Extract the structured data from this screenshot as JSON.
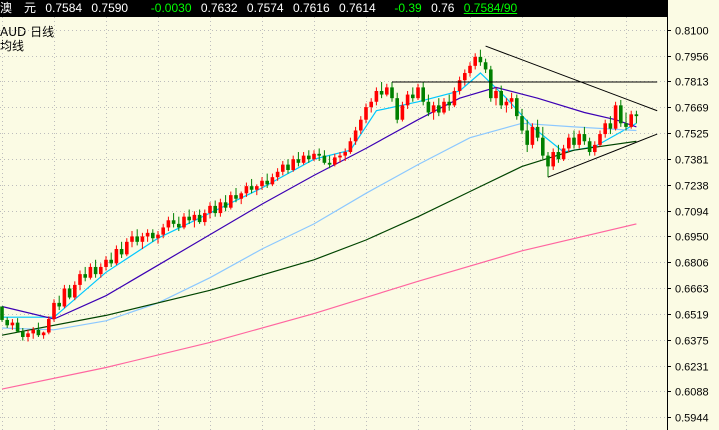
{
  "header": {
    "instrument": "澳　元",
    "open": "0.7584",
    "last": "0.7590",
    "change": "-0.0030",
    "high": "0.7632",
    "low": "0.7574",
    "prev": "0.7616",
    "bid": "0.7614",
    "change_pct": "-0.39",
    "spread": "0.76",
    "latest": "0.7584/90"
  },
  "chart_labels": {
    "symbol": "AUD",
    "period": "日线",
    "line2": "均线"
  },
  "colors": {
    "background": "#fbfbe4",
    "grid": "#bdbdbd",
    "up_candle": "#ff0000",
    "down_candle": "#008000",
    "ma_short": "#00c8ff",
    "ma_mid": "#3c00b4",
    "ma_long": "#8cc8ff",
    "ma_200": "#004400",
    "ma_500": "#ff66a0",
    "trendline": "#000000",
    "axis_bg": "#fbfbe4"
  },
  "chart_data": {
    "type": "candlestick",
    "y_ticks": [
      "0.8100",
      "0.7956",
      "0.7813",
      "0.7669",
      "0.7525",
      "0.7381",
      "0.7238",
      "0.7094",
      "0.6950",
      "0.6806",
      "0.6663",
      "0.6519",
      "0.6375",
      "0.6231",
      "0.6088",
      "0.5944"
    ],
    "ylim": [
      0.5872,
      0.8172
    ],
    "x_count": 125,
    "grid": true,
    "candles": [
      [
        0,
        0.656,
        0.652,
        0.6475,
        0.6485
      ],
      [
        1,
        0.6485,
        0.65,
        0.644,
        0.6455
      ],
      [
        2,
        0.6455,
        0.649,
        0.643,
        0.647
      ],
      [
        3,
        0.647,
        0.6495,
        0.6415,
        0.642
      ],
      [
        4,
        0.642,
        0.644,
        0.637,
        0.639
      ],
      [
        5,
        0.639,
        0.643,
        0.6365,
        0.641
      ],
      [
        6,
        0.641,
        0.6445,
        0.638,
        0.643
      ],
      [
        7,
        0.643,
        0.647,
        0.639,
        0.64
      ],
      [
        8,
        0.64,
        0.642,
        0.638,
        0.6415
      ],
      [
        9,
        0.6415,
        0.6505,
        0.6405,
        0.649
      ],
      [
        10,
        0.649,
        0.66,
        0.6475,
        0.658
      ],
      [
        11,
        0.658,
        0.662,
        0.654,
        0.656
      ],
      [
        12,
        0.656,
        0.668,
        0.655,
        0.666
      ],
      [
        13,
        0.666,
        0.668,
        0.66,
        0.661
      ],
      [
        14,
        0.661,
        0.67,
        0.6595,
        0.668
      ],
      [
        15,
        0.668,
        0.676,
        0.665,
        0.674
      ],
      [
        16,
        0.674,
        0.678,
        0.67,
        0.672
      ],
      [
        17,
        0.672,
        0.68,
        0.671,
        0.678
      ],
      [
        18,
        0.678,
        0.682,
        0.672,
        0.674
      ],
      [
        19,
        0.674,
        0.68,
        0.672,
        0.678
      ],
      [
        20,
        0.678,
        0.684,
        0.676,
        0.682
      ],
      [
        21,
        0.682,
        0.686,
        0.678,
        0.68
      ],
      [
        22,
        0.68,
        0.69,
        0.679,
        0.688
      ],
      [
        23,
        0.688,
        0.692,
        0.683,
        0.685
      ],
      [
        24,
        0.685,
        0.694,
        0.684,
        0.692
      ],
      [
        25,
        0.692,
        0.698,
        0.689,
        0.695
      ],
      [
        26,
        0.695,
        0.699,
        0.69,
        0.692
      ],
      [
        27,
        0.692,
        0.697,
        0.688,
        0.695
      ],
      [
        28,
        0.695,
        0.699,
        0.692,
        0.697
      ],
      [
        29,
        0.697,
        0.699,
        0.692,
        0.694
      ],
      [
        30,
        0.694,
        0.698,
        0.691,
        0.696
      ],
      [
        31,
        0.696,
        0.702,
        0.694,
        0.7
      ],
      [
        32,
        0.7,
        0.706,
        0.698,
        0.704
      ],
      [
        33,
        0.704,
        0.708,
        0.7,
        0.702
      ],
      [
        34,
        0.702,
        0.706,
        0.698,
        0.7
      ],
      [
        35,
        0.7,
        0.708,
        0.699,
        0.706
      ],
      [
        36,
        0.706,
        0.71,
        0.702,
        0.704
      ],
      [
        37,
        0.704,
        0.709,
        0.7,
        0.707
      ],
      [
        38,
        0.707,
        0.71,
        0.702,
        0.703
      ],
      [
        39,
        0.703,
        0.71,
        0.701,
        0.708
      ],
      [
        40,
        0.708,
        0.714,
        0.705,
        0.712
      ],
      [
        41,
        0.712,
        0.715,
        0.706,
        0.708
      ],
      [
        42,
        0.708,
        0.716,
        0.706,
        0.714
      ],
      [
        43,
        0.714,
        0.718,
        0.709,
        0.711
      ],
      [
        44,
        0.711,
        0.72,
        0.71,
        0.718
      ],
      [
        45,
        0.718,
        0.722,
        0.714,
        0.716
      ],
      [
        46,
        0.716,
        0.72,
        0.713,
        0.719
      ],
      [
        47,
        0.719,
        0.725,
        0.717,
        0.723
      ],
      [
        48,
        0.723,
        0.727,
        0.719,
        0.721
      ],
      [
        49,
        0.721,
        0.724,
        0.718,
        0.723
      ],
      [
        50,
        0.723,
        0.728,
        0.721,
        0.726
      ],
      [
        51,
        0.726,
        0.73,
        0.722,
        0.724
      ],
      [
        52,
        0.724,
        0.73,
        0.723,
        0.728
      ],
      [
        53,
        0.728,
        0.733,
        0.726,
        0.731
      ],
      [
        54,
        0.731,
        0.737,
        0.729,
        0.735
      ],
      [
        55,
        0.735,
        0.738,
        0.73,
        0.732
      ],
      [
        56,
        0.732,
        0.74,
        0.731,
        0.738
      ],
      [
        57,
        0.738,
        0.742,
        0.734,
        0.736
      ],
      [
        58,
        0.736,
        0.742,
        0.735,
        0.74
      ],
      [
        59,
        0.74,
        0.743,
        0.736,
        0.738
      ],
      [
        60,
        0.738,
        0.743,
        0.737,
        0.741
      ],
      [
        61,
        0.741,
        0.744,
        0.737,
        0.74
      ],
      [
        62,
        0.74,
        0.743,
        0.735,
        0.736
      ],
      [
        63,
        0.736,
        0.74,
        0.733,
        0.735
      ],
      [
        64,
        0.735,
        0.741,
        0.734,
        0.739
      ],
      [
        65,
        0.739,
        0.742,
        0.736,
        0.74
      ],
      [
        66,
        0.74,
        0.744,
        0.737,
        0.742
      ],
      [
        67,
        0.742,
        0.75,
        0.741,
        0.748
      ],
      [
        68,
        0.748,
        0.756,
        0.746,
        0.754
      ],
      [
        69,
        0.754,
        0.762,
        0.752,
        0.76
      ],
      [
        70,
        0.76,
        0.769,
        0.758,
        0.767
      ],
      [
        71,
        0.767,
        0.772,
        0.764,
        0.77
      ],
      [
        72,
        0.77,
        0.778,
        0.768,
        0.776
      ],
      [
        73,
        0.776,
        0.781,
        0.772,
        0.774
      ],
      [
        74,
        0.774,
        0.78,
        0.773,
        0.778
      ],
      [
        75,
        0.778,
        0.781,
        0.77,
        0.772
      ],
      [
        76,
        0.772,
        0.775,
        0.758,
        0.76
      ],
      [
        77,
        0.76,
        0.77,
        0.759,
        0.768
      ],
      [
        78,
        0.768,
        0.776,
        0.766,
        0.774
      ],
      [
        79,
        0.774,
        0.778,
        0.77,
        0.772
      ],
      [
        80,
        0.772,
        0.78,
        0.771,
        0.778
      ],
      [
        81,
        0.778,
        0.781,
        0.768,
        0.77
      ],
      [
        82,
        0.77,
        0.774,
        0.762,
        0.764
      ],
      [
        83,
        0.764,
        0.77,
        0.76,
        0.768
      ],
      [
        84,
        0.768,
        0.772,
        0.762,
        0.764
      ],
      [
        85,
        0.764,
        0.772,
        0.763,
        0.77
      ],
      [
        86,
        0.77,
        0.774,
        0.765,
        0.768
      ],
      [
        87,
        0.768,
        0.778,
        0.767,
        0.776
      ],
      [
        88,
        0.776,
        0.784,
        0.774,
        0.782
      ],
      [
        89,
        0.782,
        0.788,
        0.779,
        0.786
      ],
      [
        90,
        0.786,
        0.792,
        0.784,
        0.79
      ],
      [
        91,
        0.79,
        0.797,
        0.788,
        0.795
      ],
      [
        92,
        0.795,
        0.799,
        0.79,
        0.792
      ],
      [
        93,
        0.792,
        0.794,
        0.786,
        0.788
      ],
      [
        94,
        0.788,
        0.79,
        0.77,
        0.772
      ],
      [
        95,
        0.772,
        0.778,
        0.768,
        0.776
      ],
      [
        96,
        0.776,
        0.779,
        0.766,
        0.768
      ],
      [
        97,
        0.768,
        0.772,
        0.764,
        0.77
      ],
      [
        98,
        0.77,
        0.775,
        0.766,
        0.772
      ],
      [
        99,
        0.772,
        0.774,
        0.76,
        0.762
      ],
      [
        100,
        0.762,
        0.766,
        0.752,
        0.754
      ],
      [
        101,
        0.754,
        0.76,
        0.742,
        0.746
      ],
      [
        102,
        0.746,
        0.758,
        0.744,
        0.756
      ],
      [
        103,
        0.756,
        0.76,
        0.748,
        0.75
      ],
      [
        104,
        0.75,
        0.756,
        0.738,
        0.74
      ],
      [
        105,
        0.74,
        0.742,
        0.728,
        0.734
      ],
      [
        106,
        0.734,
        0.744,
        0.732,
        0.742
      ],
      [
        107,
        0.742,
        0.746,
        0.736,
        0.738
      ],
      [
        108,
        0.738,
        0.746,
        0.737,
        0.744
      ],
      [
        109,
        0.744,
        0.752,
        0.742,
        0.75
      ],
      [
        110,
        0.75,
        0.754,
        0.744,
        0.746
      ],
      [
        111,
        0.746,
        0.754,
        0.744,
        0.752
      ],
      [
        112,
        0.752,
        0.756,
        0.746,
        0.748
      ],
      [
        113,
        0.748,
        0.75,
        0.74,
        0.742
      ],
      [
        114,
        0.742,
        0.748,
        0.74,
        0.746
      ],
      [
        115,
        0.746,
        0.754,
        0.745,
        0.752
      ],
      [
        116,
        0.752,
        0.76,
        0.75,
        0.758
      ],
      [
        117,
        0.758,
        0.762,
        0.752,
        0.755
      ],
      [
        118,
        0.755,
        0.77,
        0.754,
        0.768
      ],
      [
        119,
        0.768,
        0.771,
        0.756,
        0.758
      ],
      [
        120,
        0.758,
        0.764,
        0.754,
        0.756
      ],
      [
        121,
        0.756,
        0.765,
        0.755,
        0.763
      ],
      [
        122,
        0.763,
        0.765,
        0.758,
        0.762
      ]
    ],
    "overlays": [
      {
        "color_key": "ma_short",
        "points": [
          [
            0,
            0.65
          ],
          [
            10,
            0.65
          ],
          [
            20,
            0.675
          ],
          [
            30,
            0.694
          ],
          [
            40,
            0.708
          ],
          [
            50,
            0.722
          ],
          [
            60,
            0.738
          ],
          [
            67,
            0.743
          ],
          [
            72,
            0.765
          ],
          [
            80,
            0.77
          ],
          [
            88,
            0.776
          ],
          [
            92,
            0.786
          ],
          [
            97,
            0.772
          ],
          [
            102,
            0.756
          ],
          [
            108,
            0.742
          ],
          [
            114,
            0.745
          ],
          [
            122,
            0.758
          ]
        ]
      },
      {
        "color_key": "ma_mid",
        "points": [
          [
            0,
            0.656
          ],
          [
            10,
            0.649
          ],
          [
            20,
            0.662
          ],
          [
            30,
            0.679
          ],
          [
            40,
            0.696
          ],
          [
            50,
            0.713
          ],
          [
            60,
            0.729
          ],
          [
            70,
            0.744
          ],
          [
            80,
            0.76
          ],
          [
            88,
            0.772
          ],
          [
            95,
            0.778
          ],
          [
            103,
            0.772
          ],
          [
            112,
            0.764
          ],
          [
            118,
            0.76
          ],
          [
            122,
            0.756
          ]
        ]
      },
      {
        "color_key": "ma_long",
        "points": [
          [
            0,
            0.644
          ],
          [
            10,
            0.643
          ],
          [
            20,
            0.648
          ],
          [
            30,
            0.658
          ],
          [
            40,
            0.672
          ],
          [
            50,
            0.688
          ],
          [
            60,
            0.702
          ],
          [
            70,
            0.719
          ],
          [
            80,
            0.735
          ],
          [
            90,
            0.75
          ],
          [
            100,
            0.758
          ],
          [
            110,
            0.756
          ],
          [
            122,
            0.754
          ]
        ]
      },
      {
        "color_key": "ma_200",
        "points": [
          [
            0,
            0.64
          ],
          [
            20,
            0.651
          ],
          [
            40,
            0.665
          ],
          [
            60,
            0.682
          ],
          [
            70,
            0.693
          ],
          [
            80,
            0.706
          ],
          [
            90,
            0.72
          ],
          [
            100,
            0.734
          ],
          [
            110,
            0.743
          ],
          [
            122,
            0.748
          ]
        ]
      },
      {
        "color_key": "ma_500",
        "points": [
          [
            0,
            0.61
          ],
          [
            20,
            0.622
          ],
          [
            40,
            0.636
          ],
          [
            60,
            0.652
          ],
          [
            80,
            0.67
          ],
          [
            100,
            0.687
          ],
          [
            122,
            0.702
          ]
        ]
      }
    ],
    "trendlines": [
      {
        "from": [
          75,
          0.781
        ],
        "to": [
          126,
          0.781
        ]
      },
      {
        "from": [
          93,
          0.801
        ],
        "to": [
          126,
          0.765
        ]
      },
      {
        "from": [
          105,
          0.728
        ],
        "to": [
          126,
          0.752
        ]
      }
    ]
  }
}
